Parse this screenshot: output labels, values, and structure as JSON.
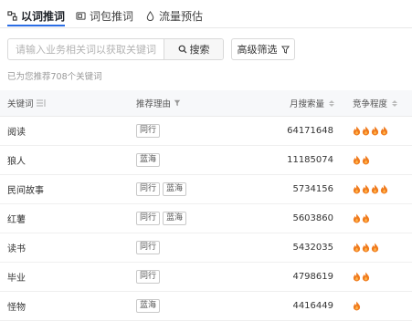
{
  "tabs": [
    {
      "label": "以词推词",
      "icon": "keyword-icon",
      "active": true
    },
    {
      "label": "词包推词",
      "icon": "package-icon",
      "active": false
    },
    {
      "label": "流量预估",
      "icon": "droplet-icon",
      "active": false
    }
  ],
  "search": {
    "placeholder": "请输入业务相关词以获取关键词",
    "value": "",
    "button_label": "搜索"
  },
  "filter": {
    "label": "高级筛选"
  },
  "hint": "已为您推荐708个关键词",
  "table": {
    "columns": [
      "关键词",
      "推荐理由",
      "月搜索量",
      "竞争程度"
    ],
    "rows": [
      {
        "keyword": "阅读",
        "tags": [
          "同行"
        ],
        "volume": "64171648",
        "competition": 4
      },
      {
        "keyword": "狼人",
        "tags": [
          "蓝海"
        ],
        "volume": "11185074",
        "competition": 2
      },
      {
        "keyword": "民间故事",
        "tags": [
          "同行",
          "蓝海"
        ],
        "volume": "5734156",
        "competition": 4
      },
      {
        "keyword": "红薯",
        "tags": [
          "同行",
          "蓝海"
        ],
        "volume": "5603860",
        "competition": 2
      },
      {
        "keyword": "读书",
        "tags": [
          "同行"
        ],
        "volume": "5432035",
        "competition": 3
      },
      {
        "keyword": "毕业",
        "tags": [
          "同行"
        ],
        "volume": "4798619",
        "competition": 2
      },
      {
        "keyword": "怪物",
        "tags": [
          "蓝海"
        ],
        "volume": "4416449",
        "competition": 1
      }
    ]
  },
  "colors": {
    "accent": "#2b6de5",
    "flame": "#f07b1e"
  }
}
